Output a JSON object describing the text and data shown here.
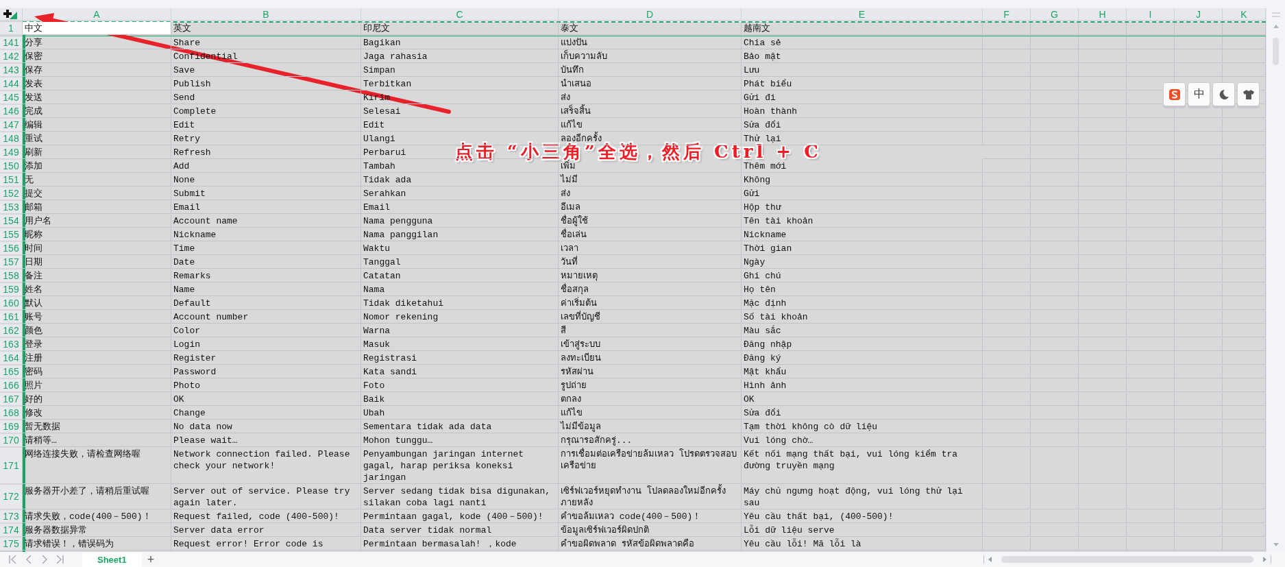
{
  "sheet": {
    "all_selected": true
  },
  "columns": [
    "A",
    "B",
    "C",
    "D",
    "E",
    "F",
    "G",
    "H",
    "I",
    "J",
    "K"
  ],
  "header_row": {
    "number": "1",
    "cells": [
      {
        "text": "中文",
        "active": true
      },
      {
        "text": "英文",
        "active": false
      },
      {
        "text": "印尼文",
        "active": false
      },
      {
        "text": "泰文",
        "active": false
      },
      {
        "text": "越南文",
        "active": false
      }
    ]
  },
  "rows": [
    {
      "number": "141",
      "cells": [
        "分享",
        "Share",
        "Bagikan",
        "แบ่งปัน",
        "Chia sẻ"
      ]
    },
    {
      "number": "142",
      "cells": [
        "保密",
        "Confidential",
        "Jaga rahasia",
        "เก็บความลับ",
        "Bảo mật"
      ]
    },
    {
      "number": "143",
      "cells": [
        "保存",
        "Save",
        "Simpan",
        "บันทึก",
        "Lưu"
      ]
    },
    {
      "number": "144",
      "cells": [
        "发表",
        "Publish",
        "Terbitkan",
        "นำเสนอ",
        "Phát biểu"
      ]
    },
    {
      "number": "145",
      "cells": [
        "发送",
        "Send",
        "Kirim",
        "ส่ง",
        "Gửi đi"
      ]
    },
    {
      "number": "146",
      "cells": [
        "完成",
        "Complete",
        "Selesai",
        "เสร็จสิ้น",
        "Hoàn thành"
      ]
    },
    {
      "number": "147",
      "cells": [
        "编辑",
        "Edit",
        "Edit",
        "แก้ไข",
        "Sửa đổi"
      ]
    },
    {
      "number": "148",
      "cells": [
        "重试",
        "Retry",
        "Ulangi",
        "ลองอีกครั้ง",
        "Thử lại"
      ]
    },
    {
      "number": "149",
      "cells": [
        "刷新",
        "Refresh",
        "Perbarui",
        null,
        null
      ]
    },
    {
      "number": "150",
      "cells": [
        "添加",
        "Add",
        "Tambah",
        "เพิ่ม",
        "Thêm mới"
      ]
    },
    {
      "number": "151",
      "cells": [
        "无",
        "None",
        "Tidak ada",
        "ไม่มี",
        "Không"
      ]
    },
    {
      "number": "152",
      "cells": [
        "提交",
        "Submit",
        "Serahkan",
        "ส่ง",
        "Gửi"
      ]
    },
    {
      "number": "153",
      "cells": [
        "邮箱",
        "Email",
        "Email",
        "อีเมล",
        "Hộp thư"
      ]
    },
    {
      "number": "154",
      "cells": [
        "用户名",
        "Account name",
        "Nama pengguna",
        "ชื่อผู้ใช้",
        "Tên tài khoản"
      ]
    },
    {
      "number": "155",
      "cells": [
        "昵称",
        "Nickname",
        "Nama panggilan",
        "ชื่อเล่น",
        "Nickname"
      ]
    },
    {
      "number": "156",
      "cells": [
        "时间",
        "Time",
        "Waktu",
        "เวลา",
        "Thời gian"
      ]
    },
    {
      "number": "157",
      "cells": [
        "日期",
        "Date",
        "Tanggal",
        "วันที่",
        "Ngày"
      ]
    },
    {
      "number": "158",
      "cells": [
        "备注",
        "Remarks",
        "Catatan",
        "หมายเหตุ",
        "Ghi chú"
      ]
    },
    {
      "number": "159",
      "cells": [
        "姓名",
        "Name",
        "Nama",
        "ชื่อสกุล",
        "Họ tên"
      ]
    },
    {
      "number": "160",
      "cells": [
        "默认",
        "Default",
        "Tidak diketahui",
        "ค่าเริ่มต้น",
        "Mặc định"
      ]
    },
    {
      "number": "161",
      "cells": [
        "账号",
        "Account number",
        "Nomor rekening",
        "เลขที่บัญชี",
        "Số tài khoản"
      ]
    },
    {
      "number": "162",
      "cells": [
        "颜色",
        "Color",
        "Warna",
        "สี",
        "Màu sắc"
      ]
    },
    {
      "number": "163",
      "cells": [
        "登录",
        "Login",
        "Masuk",
        "เข้าสู่ระบบ",
        "Đăng nhập"
      ]
    },
    {
      "number": "164",
      "cells": [
        "注册",
        "Register",
        "Registrasi",
        "ลงทะเบียน",
        "Đăng ký"
      ]
    },
    {
      "number": "165",
      "cells": [
        "密码",
        "Password",
        "Kata sandi",
        "รหัสผ่าน",
        "Mật khẩu"
      ]
    },
    {
      "number": "166",
      "cells": [
        "照片",
        "Photo",
        "Foto",
        "รูปถ่าย",
        "Hình ảnh"
      ]
    },
    {
      "number": "167",
      "cells": [
        "好的",
        "OK",
        "Baik",
        "ตกลง",
        "OK"
      ]
    },
    {
      "number": "168",
      "cells": [
        "修改",
        "Change",
        "Ubah",
        "แก้ไข",
        "Sửa đổi"
      ]
    },
    {
      "number": "169",
      "cells": [
        "暂无数据",
        "No data now",
        "Sementara tidak ada data",
        "ไม่มีข้อมูล",
        "Tạm thời không cò dữ liệu"
      ]
    },
    {
      "number": "170",
      "cells": [
        "请稍等…",
        "Please wait…",
        "Mohon tunggu…",
        "กรุณารอสักครู่...",
        "Vui lóng chờ…"
      ]
    },
    {
      "number": "171",
      "cells": [
        "网络连接失败，请检查网络喔",
        "Network connection failed. Please check your network!",
        "Penyambungan jaringan internet gagal, harap periksa koneksi jaringan",
        "การเชื่อมต่อเครือข่ายล้มเหลว โปรดตรวจสอบเครือข่าย",
        "Kết nối mạng thất bại, vui lóng kiểm tra đường truyền mạng"
      ]
    },
    {
      "number": "172",
      "cells": [
        "服务器开小差了，请稍后重试喔",
        "Server out of service. Please try again later.",
        "Server sedang tidak bisa digunakan, silakan coba lagi nanti",
        "เซิร์ฟเวอร์หยุดทำงาน โปลดลองใหม่อีกครั้งภายหลัง",
        "Máy chủ ngưng hoạt động, vui lóng thử lại sau"
      ]
    },
    {
      "number": "173",
      "cells": [
        "请求失败，code(400－500)！",
        "Request failed, code (400-500)!",
        "Permintaan gagal, kode (400－500)!",
        "คำขอล้มเหลว code(400－500)！",
        "Yêu cầu thất bại, (400-500)!"
      ]
    },
    {
      "number": "174",
      "cells": [
        "服务器数据异常",
        "Server data error",
        "Data server tidak normal",
        "ข้อมูลเซิร์ฟเวอร์ผิดปกติ",
        "Lỗi dữ liệu serve"
      ]
    },
    {
      "number": "175",
      "cells": [
        "请求错误！，错误码为",
        "Request error! Error code is",
        "Permintaan bermasalah! ，kode",
        "คำขอผิดพลาด  รหัสข้อผิดพลาดคือ",
        "Yêu cầu lỗi! Mã lỗi là"
      ]
    }
  ],
  "annotation": {
    "text": "点击 “小三角”全选，然后 Ctrl + C"
  },
  "ime_toolbar": [
    {
      "kind": "logo"
    },
    {
      "kind": "text",
      "label": "中"
    },
    {
      "kind": "moon"
    },
    {
      "kind": "shirt"
    }
  ],
  "sheet_tabs": [
    {
      "label": "Sheet1",
      "selected": true
    }
  ],
  "add_sheet": {
    "label": "+"
  }
}
